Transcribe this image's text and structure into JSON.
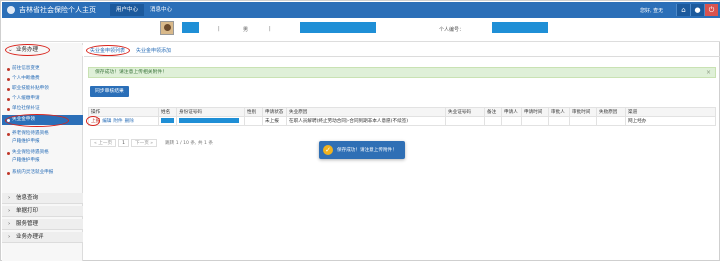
{
  "header": {
    "title": "吉林省社会保险个人主页",
    "tabs": [
      {
        "label": "用户中心",
        "active": true
      },
      {
        "label": "消息中心",
        "active": false
      }
    ],
    "user_label": "您好, 查无",
    "accent_color": "#2b6fb8"
  },
  "info": {
    "sep1": "|",
    "gender": "男",
    "sep2": "|",
    "id_label": "个人编号："
  },
  "sidebar": {
    "groups": [
      {
        "label": "业务办理",
        "icon": "chevron-down-icon",
        "expanded": true
      },
      {
        "label": "信息查询",
        "icon": "chevron-right-icon"
      },
      {
        "label": "单据打印",
        "icon": "chevron-right-icon"
      },
      {
        "label": "服务管理",
        "icon": "chevron-right-icon"
      },
      {
        "label": "业务办理评",
        "icon": "chevron-right-icon"
      }
    ],
    "items": [
      {
        "label": "前往信息变更"
      },
      {
        "label": "个人中断缴费"
      },
      {
        "label": "职业技能补贴申领"
      },
      {
        "label": "个人缓缴申请"
      },
      {
        "label": "单位社保补证"
      },
      {
        "label": "失业金申领",
        "active": true
      },
      {
        "label": "养老保险待遇资格"
      },
      {
        "label": "户籍维护申报"
      },
      {
        "label": "失业保险待遇资格"
      },
      {
        "label": "户籍维护申报"
      },
      {
        "label": "系统内灵活就业申报"
      }
    ]
  },
  "main": {
    "subtabs": [
      {
        "label": "失业金申领列表",
        "active": true
      },
      {
        "label": "失业金申领添加",
        "active": false
      }
    ],
    "alert_text": "保存成功！请注意上传相关附件！",
    "alert_close": "×",
    "sync_button": "同步审核结果",
    "table": {
      "headers": [
        "操作",
        "姓名",
        "身份证号码",
        "性别",
        "申请状态",
        "失业原因",
        "失业证号码",
        "备注",
        "申请人",
        "申请时间",
        "审批人",
        "审批时间",
        "失败原因",
        "渠道"
      ],
      "rows": [
        {
          "ops": [
            "上报",
            "编辑",
            "附件",
            "删除"
          ],
          "gender": "",
          "status": "未上报",
          "reason": "在职人员解聘(终止劳动合同)-合同到期非本人意愿(不续签)",
          "channel": "网上经办"
        }
      ]
    },
    "pager": {
      "prev": "« 上一页",
      "page": "1",
      "next": "下一页 »",
      "info": "跳转  1  / 10  条, 共 1 条"
    }
  },
  "toast": {
    "text": "保存成功！请注意上传附件！",
    "icon": "check-icon"
  }
}
